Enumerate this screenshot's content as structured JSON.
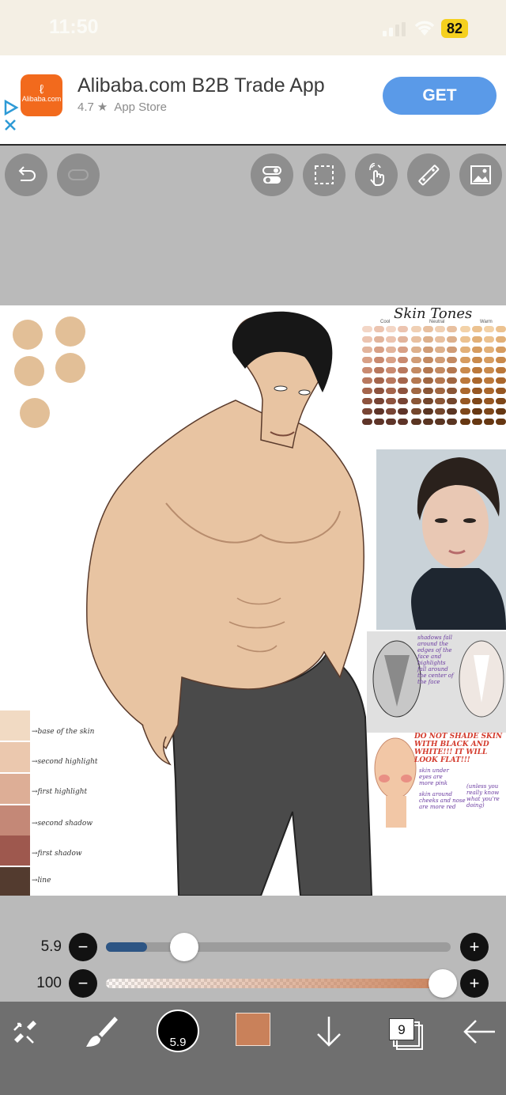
{
  "status_bar": {
    "time": "11:50",
    "battery": "82"
  },
  "ad": {
    "title": "Alibaba.com B2B Trade App",
    "logo_text": "Alibaba.com",
    "rating": "4.7",
    "store": "App Store",
    "cta": "GET"
  },
  "toolbar": {
    "left": [
      "undo-icon",
      "redo-icon"
    ],
    "right": [
      "toggle-icon",
      "selection-icon",
      "gesture-icon",
      "ruler-icon",
      "image-icon"
    ]
  },
  "canvas": {
    "skin_title": "Skin Tones",
    "tone_columns": [
      "Cool",
      "Neutral",
      "Warm"
    ],
    "palette_labels": [
      "base of the skin",
      "second highlight",
      "first highlight",
      "second shadow",
      "first shadow",
      "line"
    ],
    "notes": {
      "contour": "shadows fall around the edges of the face and highlights fall around the center of the face",
      "warning": "DO NOT SHADE SKIN WITH BLACK AND WHITE!!! IT WILL LOOK FLAT!!!",
      "under_eyes": "skin under eyes are more pink",
      "cheeks": "skin around cheeks and nose are more red",
      "unless": "(unless you really know what you're doing)"
    }
  },
  "sliders": {
    "size": {
      "value": "5.9",
      "fraction": 0.12
    },
    "opacity": {
      "value": "100",
      "fraction": 1.0
    }
  },
  "bottom_bar": {
    "brush_size": "5.9",
    "layers_count": "9",
    "colors": {
      "primary": "#c9815a",
      "track_fill": "#2d5584"
    }
  }
}
